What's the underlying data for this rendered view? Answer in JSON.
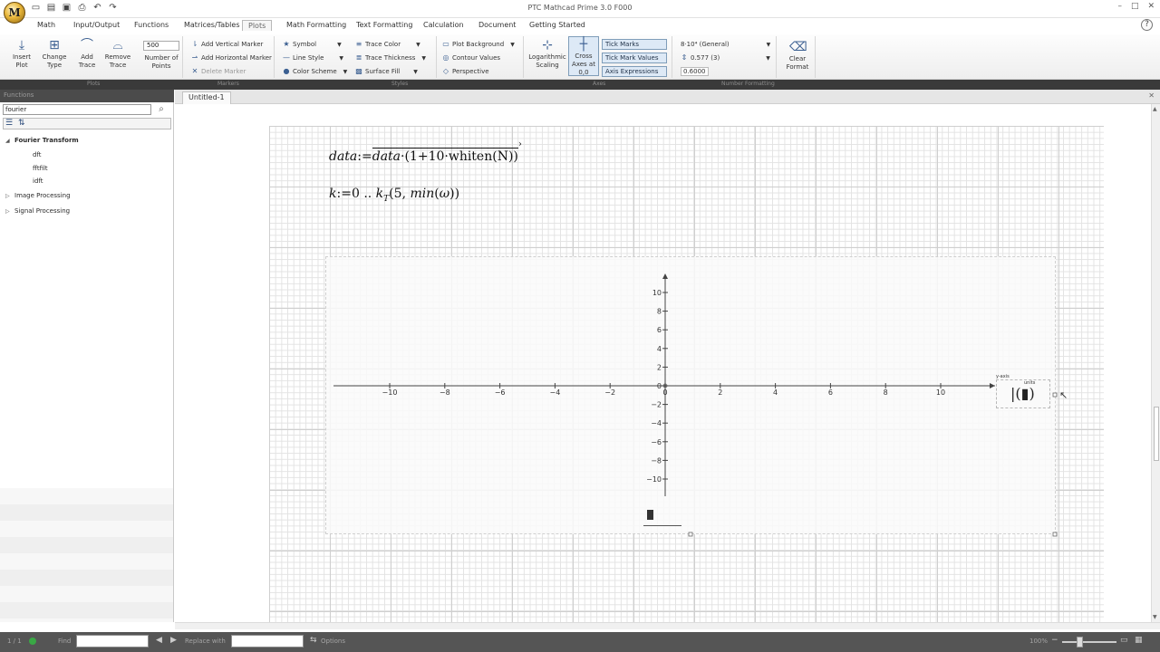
{
  "window": {
    "title": "PTC Mathcad Prime 3.0 F000",
    "logo_letter": "M"
  },
  "ribbon_tabs": [
    "Math",
    "Input/Output",
    "Functions",
    "Matrices/Tables",
    "Plots",
    "Math Formatting",
    "Text Formatting",
    "Calculation",
    "Document",
    "Getting Started"
  ],
  "active_tab": "Plots",
  "ribbon": {
    "insert_plot": "Insert Plot",
    "change_type": "Change Type",
    "add_trace": "Add Trace",
    "remove_trace": "Remove Trace",
    "points_value": "500",
    "number_of_points": "Number of Points",
    "add_vertical_marker": "Add Vertical Marker",
    "add_horizontal_marker": "Add Horizontal Marker",
    "delete_marker": "Delete Marker",
    "symbol": "Symbol",
    "line_style": "Line Style",
    "color_scheme": "Color Scheme",
    "trace_color": "Trace Color",
    "trace_thickness": "Trace Thickness",
    "surface_fill": "Surface Fill",
    "plot_background": "Plot Background",
    "contour_values": "Contour Values",
    "perspective": "Perspective",
    "logarithmic_scaling": "Logarithmic Scaling",
    "cross_axes": "Cross Axes at 0,0",
    "tick_marks": "Tick Marks",
    "tick_mark_values": "Tick Mark Values",
    "axis_expressions": "Axis Expressions",
    "number_format": "8·10⁴ (General)",
    "precision": "0.577 (3)",
    "precision_value": "0.6000",
    "clear_format": "Clear Format",
    "group_labels": [
      "Plots",
      "Markers",
      "Styles",
      "Axes",
      "Number Formatting"
    ]
  },
  "left_panel": {
    "header": "Functions",
    "search_value": "fourier",
    "tree": [
      {
        "label": "Fourier Transform",
        "expanded": true,
        "children": [
          "dft",
          "fftfilt",
          "idft"
        ]
      },
      {
        "label": "Image Processing",
        "expanded": false,
        "children": []
      },
      {
        "label": "Signal Processing",
        "expanded": false,
        "children": []
      }
    ]
  },
  "document": {
    "tab_label": "Untitled-1",
    "eq1": {
      "lhs": "data",
      "assign": ":=",
      "rhs_var": "data",
      "rhs_expr": "(1+10·whiten(N))"
    },
    "eq2": {
      "lhs": "k",
      "assign": ":=",
      "range_start": "0",
      "range_sep": "..",
      "fn": "k",
      "fn_sub": "T",
      "args_a": "5",
      "args_b": "min",
      "args_c": "ω"
    }
  },
  "plot": {
    "y_axis_label": "y-axis",
    "units_label": "units",
    "operand_symbol": "|(▮)",
    "x_ticks": [
      "−10",
      "−8",
      "−6",
      "−4",
      "−2",
      "0",
      "2",
      "4",
      "6",
      "8",
      "10"
    ],
    "y_ticks": [
      "10",
      "8",
      "6",
      "4",
      "2",
      "0",
      "−2",
      "−4",
      "−6",
      "−8",
      "−10"
    ]
  },
  "status": {
    "page": "1 / 1",
    "find_label": "Find",
    "replace_label": "Replace with",
    "options_label": "Options",
    "zoom": "100%"
  }
}
